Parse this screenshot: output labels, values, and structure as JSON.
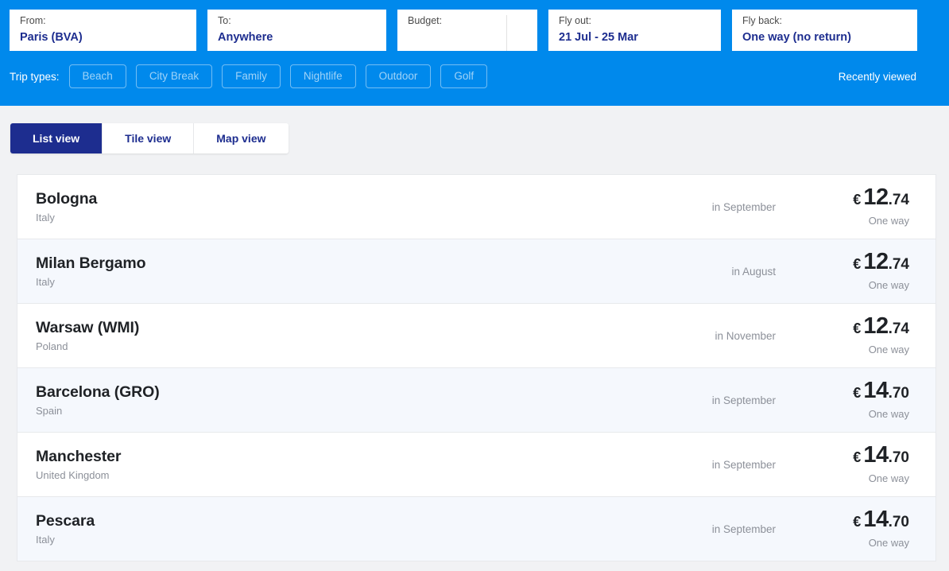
{
  "search": {
    "fields": [
      {
        "key": "from",
        "label": "From:",
        "value": "Paris (BVA)"
      },
      {
        "key": "to",
        "label": "To:",
        "value": "Anywhere"
      },
      {
        "key": "budget",
        "label": "Budget:",
        "value": ""
      },
      {
        "key": "flyout",
        "label": "Fly out:",
        "value": "21 Jul - 25 Mar"
      },
      {
        "key": "flyback",
        "label": "Fly back:",
        "value": "One way (no return)"
      }
    ],
    "trip_types_label": "Trip types:",
    "trip_types": [
      "Beach",
      "City Break",
      "Family",
      "Nightlife",
      "Outdoor",
      "Golf"
    ],
    "recently_viewed": "Recently viewed",
    "accent_blue": "#0089ec",
    "accent_navy": "#1d2d8f"
  },
  "view_tabs": [
    {
      "label": "List view",
      "active": true
    },
    {
      "label": "Tile view",
      "active": false
    },
    {
      "label": "Map view",
      "active": false
    }
  ],
  "results": [
    {
      "city": "Bologna",
      "country": "Italy",
      "month": "in September",
      "currency": "€",
      "whole": "12",
      "cents": ".74",
      "trip_kind": "One way"
    },
    {
      "city": "Milan Bergamo",
      "country": "Italy",
      "month": "in August",
      "currency": "€",
      "whole": "12",
      "cents": ".74",
      "trip_kind": "One way"
    },
    {
      "city": "Warsaw (WMI)",
      "country": "Poland",
      "month": "in November",
      "currency": "€",
      "whole": "12",
      "cents": ".74",
      "trip_kind": "One way"
    },
    {
      "city": "Barcelona (GRO)",
      "country": "Spain",
      "month": "in September",
      "currency": "€",
      "whole": "14",
      "cents": ".70",
      "trip_kind": "One way"
    },
    {
      "city": "Manchester",
      "country": "United Kingdom",
      "month": "in September",
      "currency": "€",
      "whole": "14",
      "cents": ".70",
      "trip_kind": "One way"
    },
    {
      "city": "Pescara",
      "country": "Italy",
      "month": "in September",
      "currency": "€",
      "whole": "14",
      "cents": ".70",
      "trip_kind": "One way"
    }
  ]
}
